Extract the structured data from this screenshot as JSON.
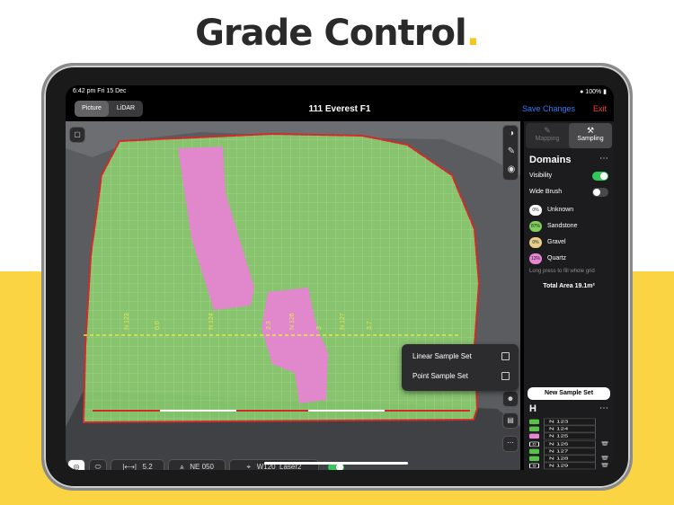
{
  "headline": {
    "text": "Grade Control",
    "dot": "."
  },
  "status": {
    "time": "6:42 pm  Fri 15 Dec",
    "battery": "100%"
  },
  "nav": {
    "seg_picture": "Picture",
    "seg_lidar": "LiDAR",
    "title": "111 Everest F1",
    "save": "Save Changes",
    "exit": "Exit"
  },
  "map": {
    "grid_labels": [
      "N 123",
      "0.0",
      "N 124",
      "2.3",
      "N 126",
      "3",
      "N 127",
      "3.7"
    ],
    "popup": {
      "linear": "Linear Sample Set",
      "point": "Point Sample Set"
    }
  },
  "bottom": {
    "width_value": "5.2",
    "bearing": "NE 050",
    "laser": "W120_Laser2"
  },
  "panel": {
    "tab_mapping": "Mapping",
    "tab_sampling": "Sampling",
    "domains_title": "Domains",
    "visibility": "Visibility",
    "wide_brush": "Wide Brush",
    "domains": [
      {
        "pct": "0%",
        "name": "Unknown",
        "color": "#ffffff"
      },
      {
        "pct": "87%",
        "name": "Sandstone",
        "color": "#7fce5e"
      },
      {
        "pct": "0%",
        "name": "Gravel",
        "color": "#e8cf8a"
      },
      {
        "pct": "13%",
        "name": "Quartz",
        "color": "#e685d2"
      }
    ],
    "hint": "Long press to fill whole grid",
    "total_area": "Total Area 19.1m²",
    "new_sample_set": "New Sample Set",
    "h_title": "H",
    "h_items": [
      {
        "name": "N 123",
        "icon": "comment-icon",
        "icon_color": "#5bc04a",
        "letter": "",
        "deletable": false
      },
      {
        "name": "N 124",
        "icon": "comment-icon",
        "icon_color": "#5bc04a",
        "letter": "",
        "deletable": false
      },
      {
        "name": "N 125",
        "icon": "comment-icon",
        "icon_color": "#e685d2",
        "letter": "",
        "deletable": false
      },
      {
        "name": "N 126",
        "icon": "d-icon",
        "icon_color": "#ffffff",
        "letter": "D",
        "deletable": true
      },
      {
        "name": "N 127",
        "icon": "comment-icon",
        "icon_color": "#5bc04a",
        "letter": "",
        "deletable": false
      },
      {
        "name": "N 128",
        "icon": "comment-icon",
        "icon_color": "#5bc04a",
        "letter": "",
        "deletable": true
      },
      {
        "name": "N 129",
        "icon": "s-icon",
        "icon_color": "#ffffff",
        "letter": "S",
        "deletable": true
      }
    ]
  },
  "colors": {
    "accent": "#2f7df6",
    "exit": "#ff3b30",
    "toggle_on": "#34c759",
    "sandstone": "#7fce5e",
    "quartz": "#e685d2",
    "boundary": "#d12a2a",
    "band": "#fbd443"
  }
}
